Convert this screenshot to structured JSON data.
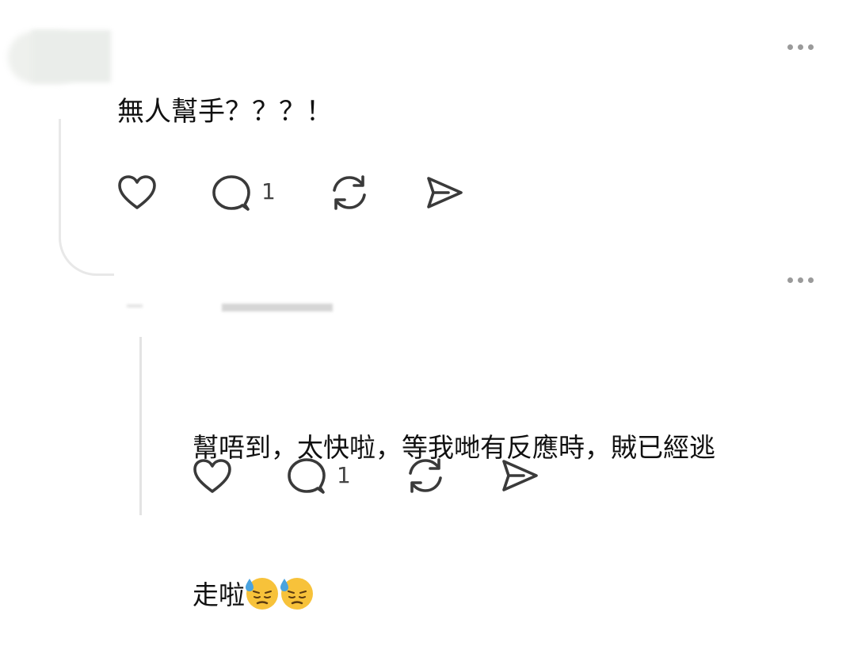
{
  "post1": {
    "text": "無人幫手？？？！",
    "reply_count": "1",
    "icons": [
      "like-icon",
      "comment-icon",
      "repost-icon",
      "share-icon"
    ]
  },
  "post2": {
    "text_line1": "幫唔到，太快啦，等我哋有反應時，賊已經逃",
    "text_line2": "走啦",
    "emoji": [
      "downcast-face-with-sweat",
      "downcast-face-with-sweat"
    ],
    "reply_count": "1",
    "icons": [
      "like-icon",
      "comment-icon",
      "repost-icon",
      "share-icon"
    ]
  },
  "colors": {
    "icon": "#3a3a3a",
    "text": "#111111",
    "count": "#444444",
    "thread_line": "#e3e3e3",
    "emoji_face": "#f7c23a",
    "emoji_sweat": "#4aa3df"
  }
}
